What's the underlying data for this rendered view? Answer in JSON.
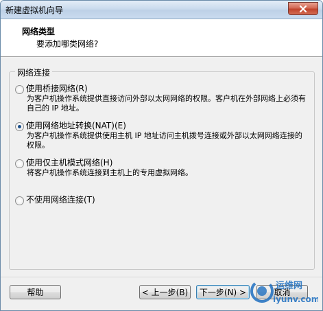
{
  "window": {
    "title": "新建虚拟机向导"
  },
  "header": {
    "title": "网络类型",
    "subtitle": "要添加哪类网络?"
  },
  "group": {
    "legend": "网络连接"
  },
  "options": [
    {
      "label": "使用桥接网络(R)",
      "description": "为客户机操作系统提供直接访问外部以太网网络的权限。客户机在外部网络上必须有自己的 IP 地址。",
      "selected": false
    },
    {
      "label": "使用网络地址转换(NAT)(E)",
      "description": "为客户机操作系统提供使用主机 IP 地址访问主机拨号连接或外部以太网网络连接的权限。",
      "selected": true
    },
    {
      "label": "使用仅主机模式网络(H)",
      "description": "将客户机操作系统连接到主机上的专用虚拟网络。",
      "selected": false
    },
    {
      "label": "不使用网络连接(T)",
      "description": "",
      "selected": false
    }
  ],
  "buttons": {
    "help": "帮助",
    "back": "< 上一步(B)",
    "next": "下一步(N) >",
    "cancel": "取消"
  },
  "watermark": {
    "brand": "运维网",
    "url": "iyunv.com"
  },
  "colors": {
    "radio_dot": "#1b4f8a",
    "watermark_blue": "#1e6fc0",
    "close_red": "#c0442c"
  }
}
